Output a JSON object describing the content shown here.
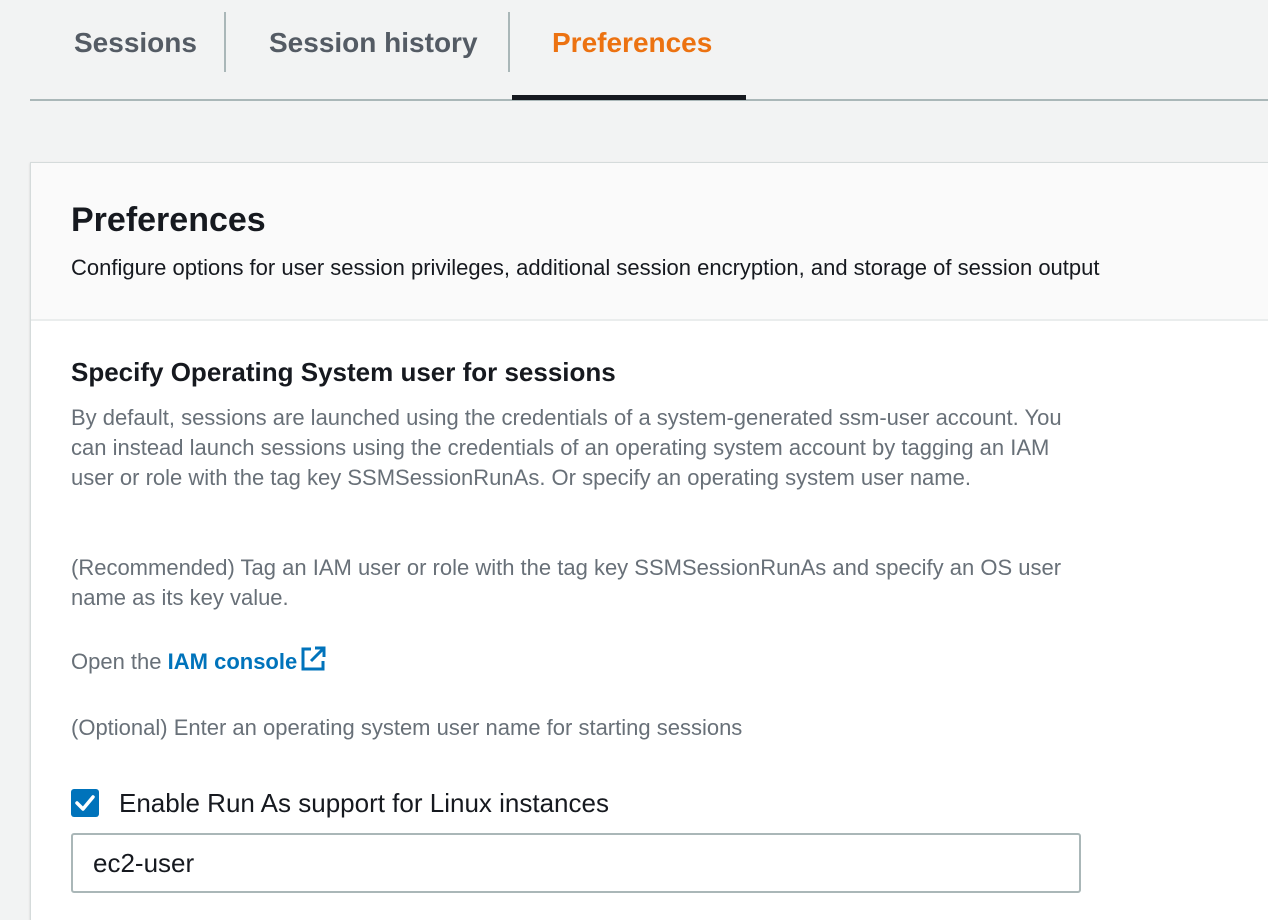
{
  "tabs": [
    {
      "label": "Sessions",
      "active": false
    },
    {
      "label": "Session history",
      "active": false
    },
    {
      "label": "Preferences",
      "active": true
    }
  ],
  "panel": {
    "title": "Preferences",
    "description": "Configure options for user session privileges, additional session encryption, and storage of session output"
  },
  "run_as": {
    "section_title": "Specify Operating System user for sessions",
    "intro": "By default, sessions are launched using the credentials of a system-generated ssm-user account. You can instead launch sessions using the credentials of an operating system account by tagging an IAM user or role with the tag key SSMSessionRunAs. Or specify an operating system user name.",
    "recommended": "(Recommended) Tag an IAM user or role with the tag key SSMSessionRunAs and specify an OS user name as its key value.",
    "open_prefix": "Open the ",
    "iam_link": "IAM console",
    "optional_hint": "(Optional) Enter an operating system user name for starting sessions",
    "checkbox_label": "Enable Run As support for Linux instances",
    "checkbox_checked": true,
    "username_value": "ec2-user"
  },
  "colors": {
    "accent": "#ec7211",
    "link": "#0073bb",
    "checkbox": "#0073bb",
    "text": "#16191f",
    "muted": "#687078"
  },
  "icons": {
    "external_link": "external-link-icon",
    "checkmark": "checkmark-icon"
  }
}
